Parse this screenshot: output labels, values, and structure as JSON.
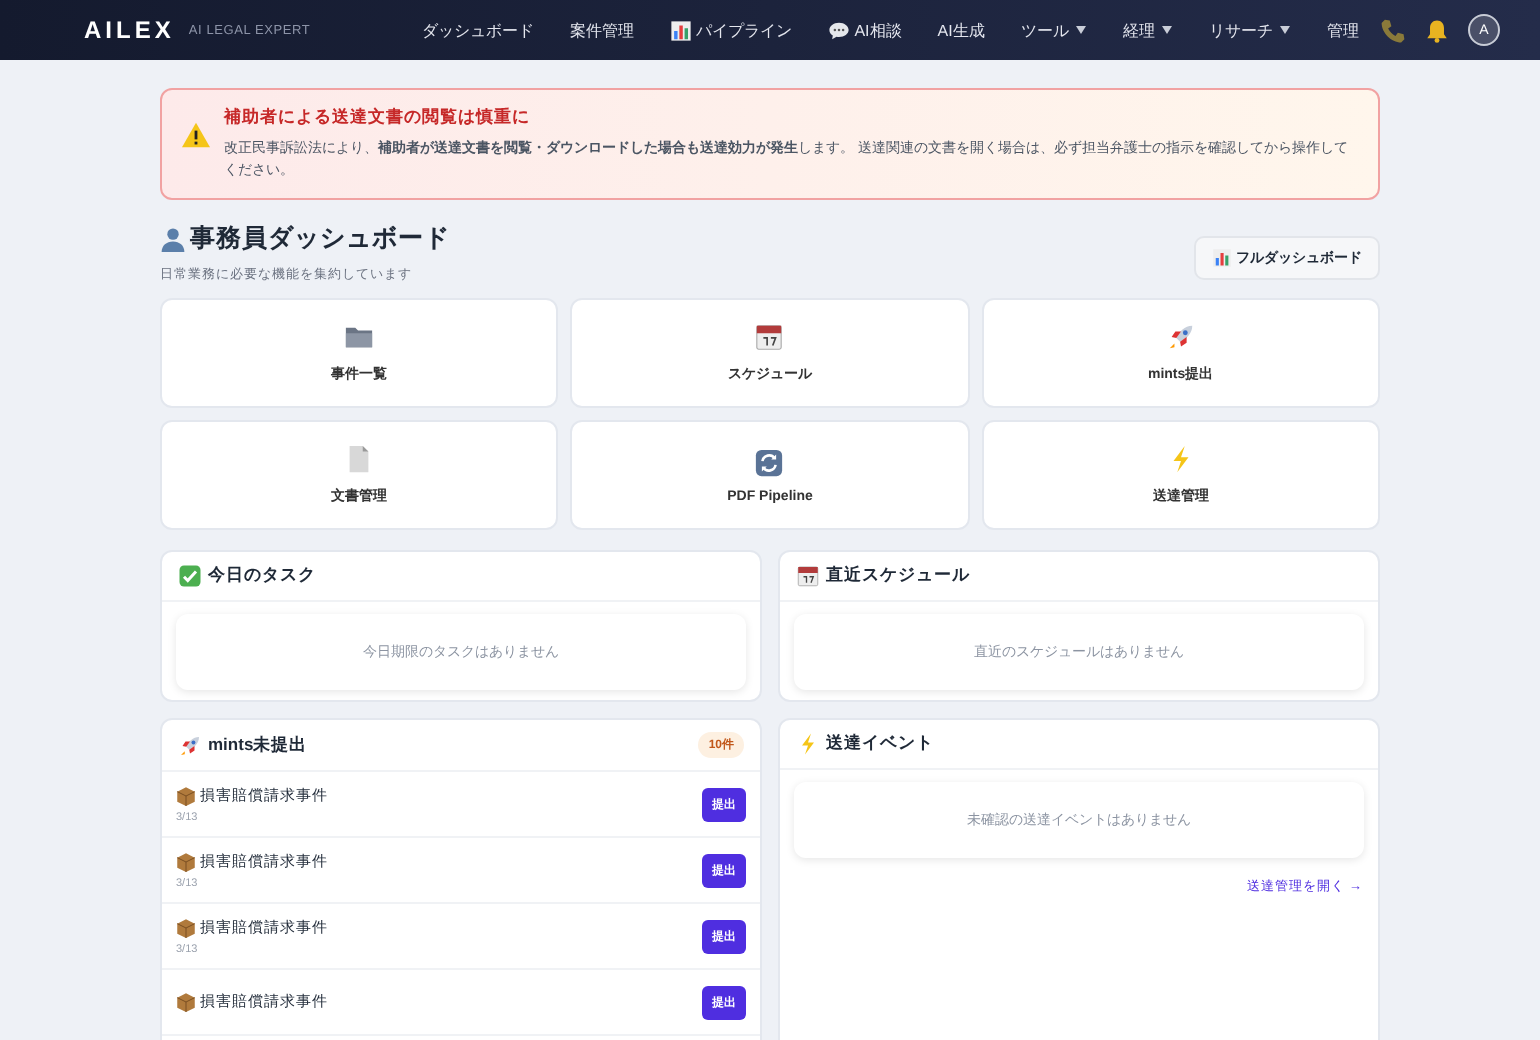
{
  "navbar": {
    "logo": "AILEX",
    "tagline": "AI LEGAL EXPERT",
    "items": [
      {
        "label": "ダッシュボード",
        "kind": "plain",
        "dropdown": false
      },
      {
        "label": "案件管理",
        "kind": "plain",
        "dropdown": false
      },
      {
        "label": "パイプライン",
        "kind": "chart",
        "dropdown": false
      },
      {
        "label": "AI相談",
        "kind": "chat",
        "dropdown": false
      },
      {
        "label": "AI生成",
        "kind": "plain",
        "dropdown": false
      },
      {
        "label": "ツール",
        "kind": "plain",
        "dropdown": true
      },
      {
        "label": "経理",
        "kind": "plain",
        "dropdown": true
      },
      {
        "label": "リサーチ",
        "kind": "plain",
        "dropdown": true
      },
      {
        "label": "管理",
        "kind": "plain",
        "dropdown": false
      }
    ],
    "avatar": "A"
  },
  "alert": {
    "title": "補助者による送達文書の閲覧は慎重に",
    "text": "改正民事訴訟法により、**補助者が送達文書を閲覧・ダウンロードした場合も送達効力が発生**します。 送達関連の文書を開く場合は、必ず担当弁護士の指示を確認してから操作してください。"
  },
  "header": {
    "title": "事務員ダッシュボード",
    "subtitle": "日常業務に必要な機能を集約しています",
    "button": "フルダッシュボード"
  },
  "tiles": [
    {
      "label": "事件一覧"
    },
    {
      "label": "スケジュール"
    },
    {
      "label": "mints提出"
    },
    {
      "label": "文書管理"
    },
    {
      "label": "PDF Pipeline"
    },
    {
      "label": "送達管理"
    }
  ],
  "panels": [
    {
      "title": "今日のタスク",
      "empty": "今日期限のタスクはありません"
    },
    {
      "title": "直近スケジュール",
      "empty": "直近のスケジュールはありません"
    }
  ],
  "mints": {
    "title": "mints未提出",
    "count": "10件",
    "items": [
      {
        "name": "損害賠償請求事件",
        "date": "3/13",
        "button": "提出"
      },
      {
        "name": "損害賠償請求事件",
        "date": "3/13",
        "button": "提出"
      },
      {
        "name": "損害賠償請求事件",
        "date": "3/13",
        "button": "提出"
      },
      {
        "name": "損害賠償請求事件",
        "button": "提出"
      }
    ]
  },
  "events": {
    "title": "送達イベント",
    "empty": "未確認の送達イベントはありません",
    "link": "送達管理を開く →"
  }
}
